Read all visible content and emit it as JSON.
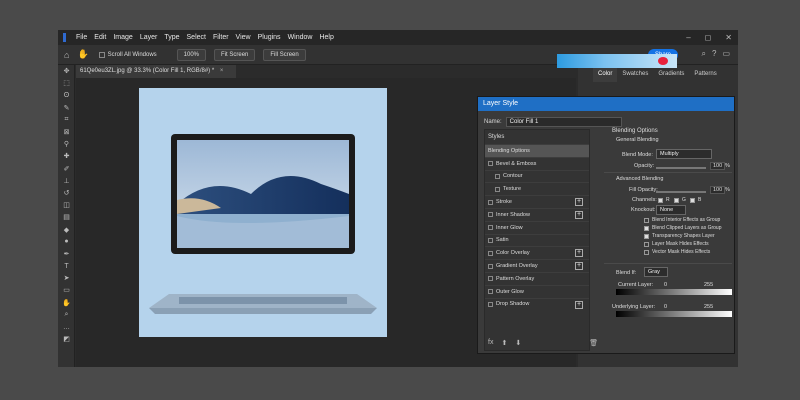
{
  "menu": [
    "File",
    "Edit",
    "Image",
    "Layer",
    "Type",
    "Select",
    "Filter",
    "View",
    "Plugins",
    "Window",
    "Help"
  ],
  "window_controls": [
    "–",
    "◻",
    "✕"
  ],
  "options": {
    "scroll_all_windows": "Scroll All Windows",
    "zoom": "100%",
    "fit_screen": "Fit Screen",
    "fill_screen": "Fill Screen",
    "share": "Share"
  },
  "document": {
    "tab_title": "61Qe0eu3ZL.jpg @ 33.3% (Color Fill 1, RGB/8#) *",
    "close": "×"
  },
  "panels": {
    "tabs": [
      "Color",
      "Swatches",
      "Gradients",
      "Patterns"
    ]
  },
  "dialog": {
    "title": "Layer Style",
    "name_label": "Name:",
    "name_value": "Color Fill 1",
    "styles_header": "Styles",
    "styles": [
      {
        "label": "Blending Options",
        "selected": true,
        "checkbox": false,
        "plus": false,
        "indent": false
      },
      {
        "label": "Bevel & Emboss",
        "checkbox": true,
        "plus": false,
        "indent": false
      },
      {
        "label": "Contour",
        "checkbox": true,
        "plus": false,
        "indent": true
      },
      {
        "label": "Texture",
        "checkbox": true,
        "plus": false,
        "indent": true
      },
      {
        "label": "Stroke",
        "checkbox": true,
        "plus": true,
        "indent": false
      },
      {
        "label": "Inner Shadow",
        "checkbox": true,
        "plus": true,
        "indent": false
      },
      {
        "label": "Inner Glow",
        "checkbox": true,
        "plus": false,
        "indent": false
      },
      {
        "label": "Satin",
        "checkbox": true,
        "plus": false,
        "indent": false
      },
      {
        "label": "Color Overlay",
        "checkbox": true,
        "plus": true,
        "indent": false
      },
      {
        "label": "Gradient Overlay",
        "checkbox": true,
        "plus": true,
        "indent": false
      },
      {
        "label": "Pattern Overlay",
        "checkbox": true,
        "plus": false,
        "indent": false
      },
      {
        "label": "Outer Glow",
        "checkbox": true,
        "plus": false,
        "indent": false
      },
      {
        "label": "Drop Shadow",
        "checkbox": true,
        "plus": true,
        "indent": false
      }
    ],
    "fx": "fx",
    "blending": {
      "section": "Blending Options",
      "general": "General Blending",
      "blend_mode_label": "Blend Mode:",
      "blend_mode": "Multiply",
      "opacity_label": "Opacity:",
      "opacity": "100",
      "opacity_unit": "%",
      "advanced": "Advanced Blending",
      "fill_opacity_label": "Fill Opacity:",
      "fill_opacity": "100",
      "fill_unit": "%",
      "channels_label": "Channels:",
      "channels": [
        "R",
        "G",
        "B"
      ],
      "knockout_label": "Knockout:",
      "knockout": "None",
      "options": [
        {
          "label": "Blend Interior Effects as Group",
          "checked": false
        },
        {
          "label": "Blend Clipped Layers as Group",
          "checked": true
        },
        {
          "label": "Transparency Shapes Layer",
          "checked": true
        },
        {
          "label": "Layer Mask Hides Effects",
          "checked": false
        },
        {
          "label": "Vector Mask Hides Effects",
          "checked": false
        }
      ],
      "blend_if_label": "Blend If:",
      "blend_if": "Gray",
      "current_layer_label": "Current Layer:",
      "current_min": "0",
      "current_max": "255",
      "underlying_label": "Underlying Layer:",
      "underlying_min": "0",
      "underlying_max": "255"
    }
  },
  "colors": {
    "accent": "#1f6fc5",
    "share": "#1473e6",
    "artboard": "#b5d3ec",
    "swatch": "#e8213d"
  }
}
